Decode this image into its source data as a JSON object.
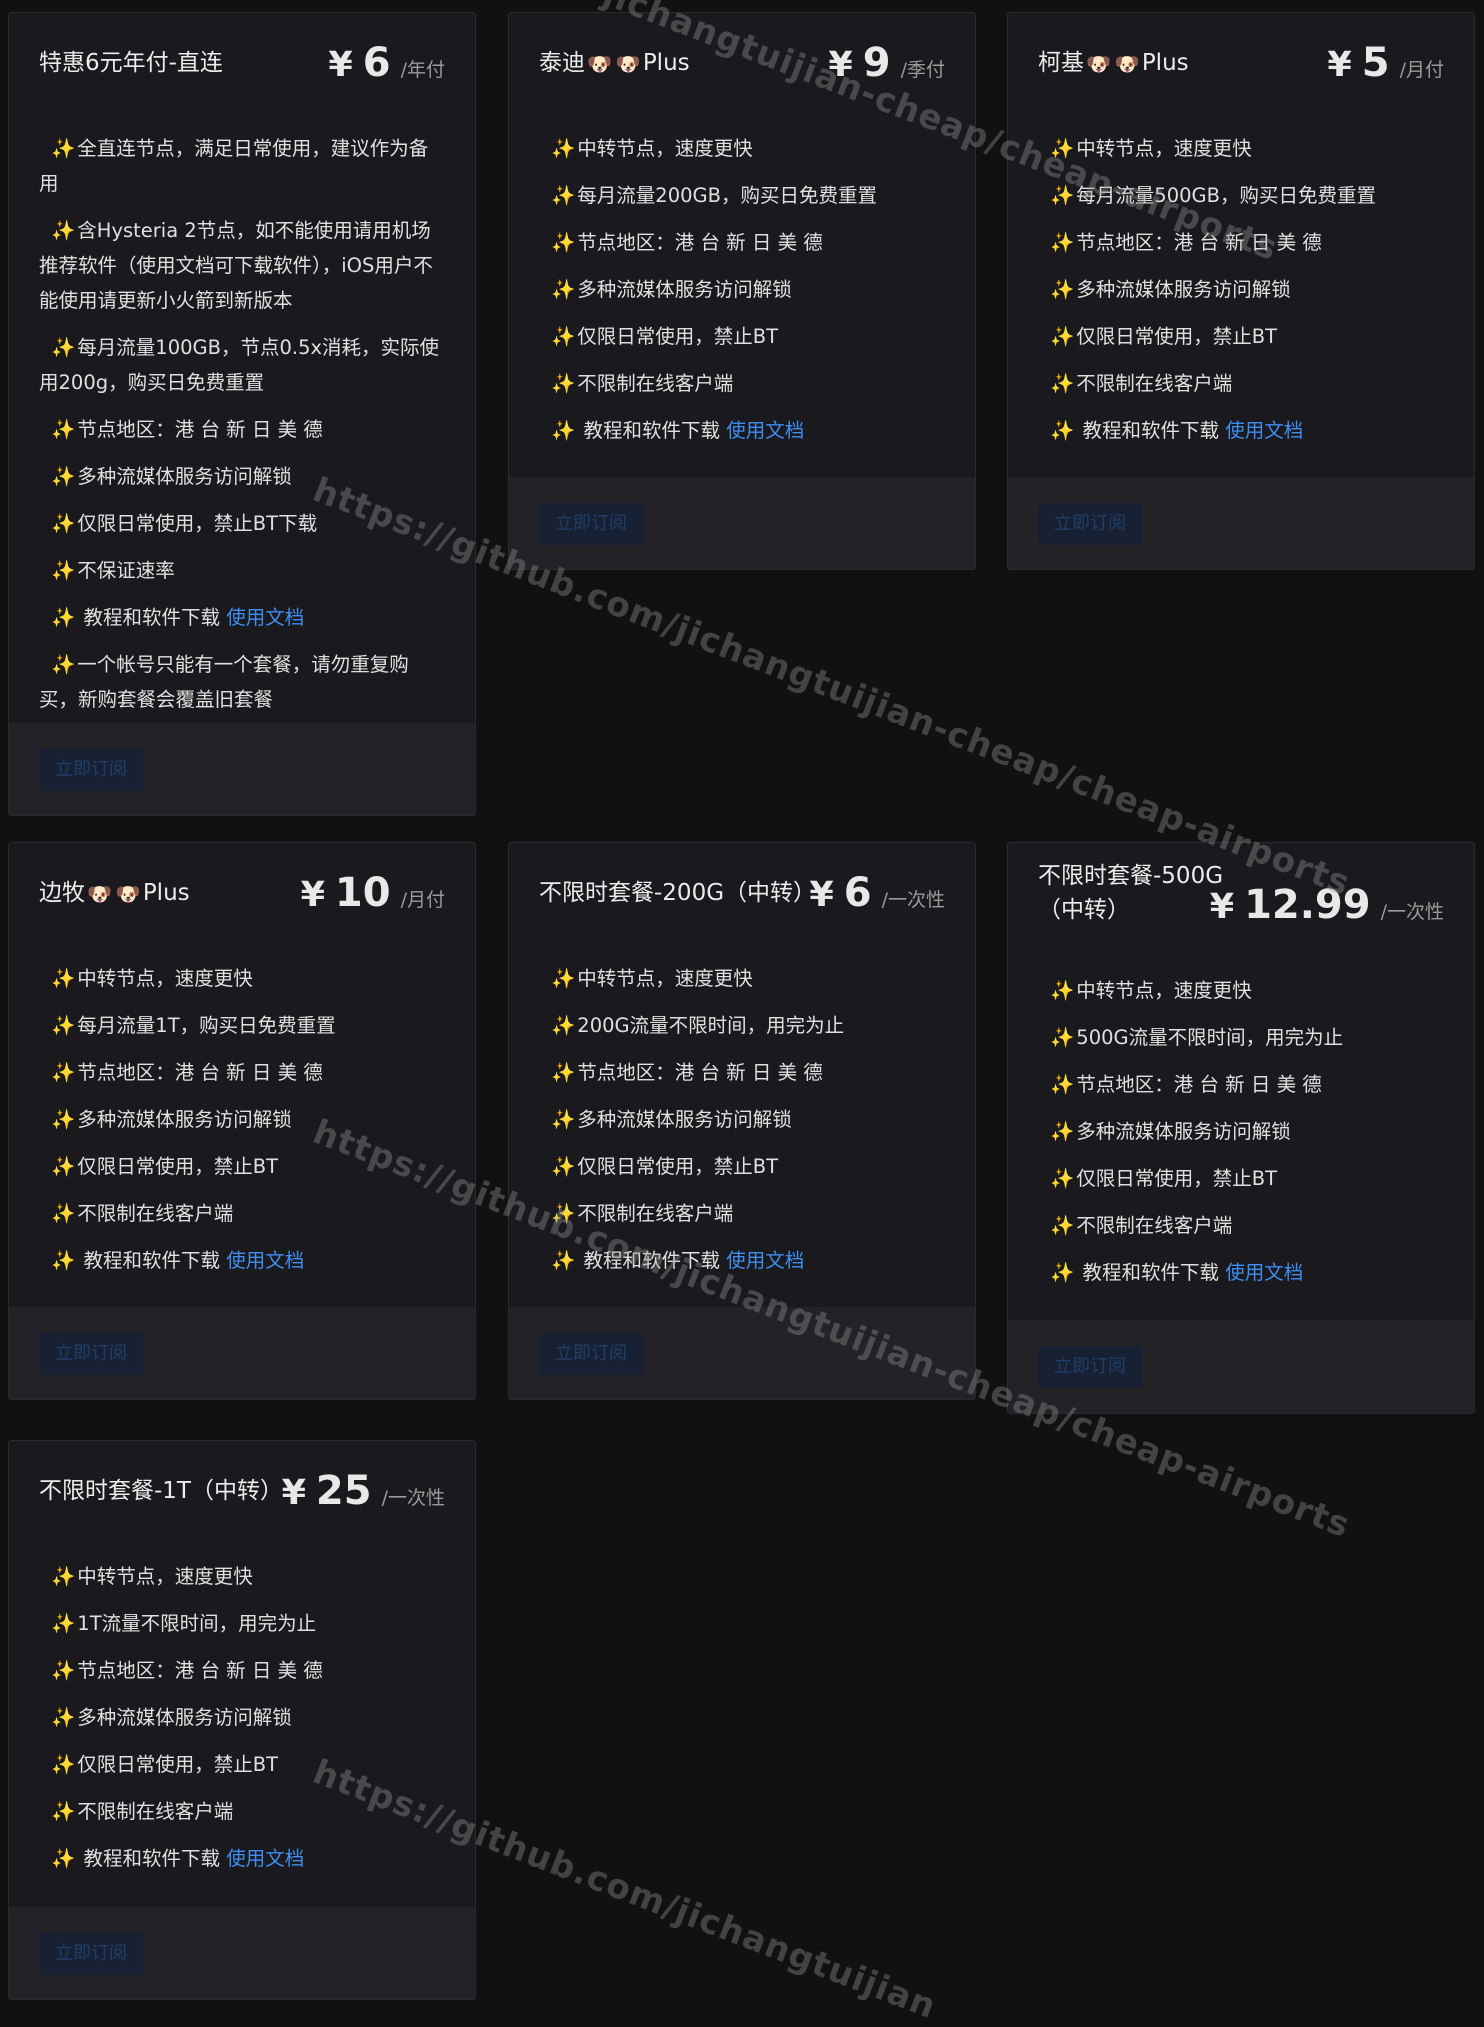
{
  "currency_symbol": "¥",
  "sparkle_glyph": "✨",
  "dog_emoji": "🐶",
  "accent_colors": {
    "background": "#111111",
    "card": "#1a1a1e",
    "link": "#3f8ef2",
    "sparkle": "#f6c64a"
  },
  "plans": [
    {
      "title": "特惠6元年付-直连",
      "price": "6",
      "period": "/年付",
      "features": [
        "全直连节点，满足日常使用，建议作为备用",
        "含Hysteria 2节点，如不能使用请用机场推荐软件（使用文档可下载软件），iOS用户不能使用请更新小火箭到新版本",
        "每月流量100GB，节点0.5x消耗，实际使用200g，购买日免费重置",
        "节点地区：港 台 新 日 美 德",
        "多种流媒体服务访问解锁",
        "仅限日常使用，禁止BT下载",
        "不保证速率",
        " 教程和软件下载 ",
        "一个帐号只能有一个套餐，请勿重复购买，新购套餐会覆盖旧套餐"
      ],
      "doc_link": "使用文档",
      "subscribe_label": "立即订阅"
    },
    {
      "title": "泰迪",
      "title_suffix": "Plus",
      "price": "9",
      "period": "/季付",
      "features": [
        "中转节点，速度更快",
        "每月流量200GB，购买日免费重置",
        "节点地区：港 台 新 日 美 德",
        "多种流媒体服务访问解锁",
        "仅限日常使用，禁止BT",
        "不限制在线客户端",
        " 教程和软件下载 "
      ],
      "doc_link": "使用文档",
      "subscribe_label": "立即订阅"
    },
    {
      "title": "柯基",
      "title_suffix": "Plus",
      "price": "5",
      "period": "/月付",
      "features": [
        "中转节点，速度更快",
        "每月流量500GB，购买日免费重置",
        "节点地区：港 台 新 日 美 德",
        "多种流媒体服务访问解锁",
        "仅限日常使用，禁止BT",
        "不限制在线客户端",
        " 教程和软件下载 "
      ],
      "doc_link": "使用文档",
      "subscribe_label": "立即订阅"
    },
    {
      "title": "边牧",
      "title_suffix": "Plus",
      "price": "10",
      "period": "/月付",
      "features": [
        "中转节点，速度更快",
        "每月流量1T，购买日免费重置",
        "节点地区：港 台 新 日 美 德",
        "多种流媒体服务访问解锁",
        "仅限日常使用，禁止BT",
        "不限制在线客户端",
        " 教程和软件下载 "
      ],
      "doc_link": "使用文档",
      "subscribe_label": "立即订阅"
    },
    {
      "title": "不限时套餐-200G（中转）",
      "price": "6",
      "period": "/一次性",
      "features": [
        "中转节点，速度更快",
        "200G流量不限时间，用完为止",
        "节点地区：港 台 新 日 美 德",
        "多种流媒体服务访问解锁",
        "仅限日常使用，禁止BT",
        "不限制在线客户端",
        " 教程和软件下载 "
      ],
      "doc_link": "使用文档",
      "subscribe_label": "立即订阅"
    },
    {
      "title": "不限时套餐-500G（中转）",
      "price": "12.99",
      "period": "/一次性",
      "features": [
        "中转节点，速度更快",
        "500G流量不限时间，用完为止",
        "节点地区：港 台 新 日 美 德",
        "多种流媒体服务访问解锁",
        "仅限日常使用，禁止BT",
        "不限制在线客户端",
        " 教程和软件下载 "
      ],
      "doc_link": "使用文档",
      "subscribe_label": "立即订阅"
    },
    {
      "title": "不限时套餐-1T（中转）",
      "price": "25",
      "period": "/一次性",
      "features": [
        "中转节点，速度更快",
        "1T流量不限时间，用完为止",
        "节点地区：港 台 新 日 美 德",
        "多种流媒体服务访问解锁",
        "仅限日常使用，禁止BT",
        "不限制在线客户端",
        " 教程和软件下载 "
      ],
      "doc_link": "使用文档",
      "subscribe_label": "立即订阅"
    }
  ],
  "watermarks": {
    "text_full": "https://github.com/jichangtuijian-cheap/cheap-airports",
    "text_top": "jichangtuijian-cheap/cheap-airports",
    "text_bottom": "https://github.com/jichangtuijian"
  }
}
